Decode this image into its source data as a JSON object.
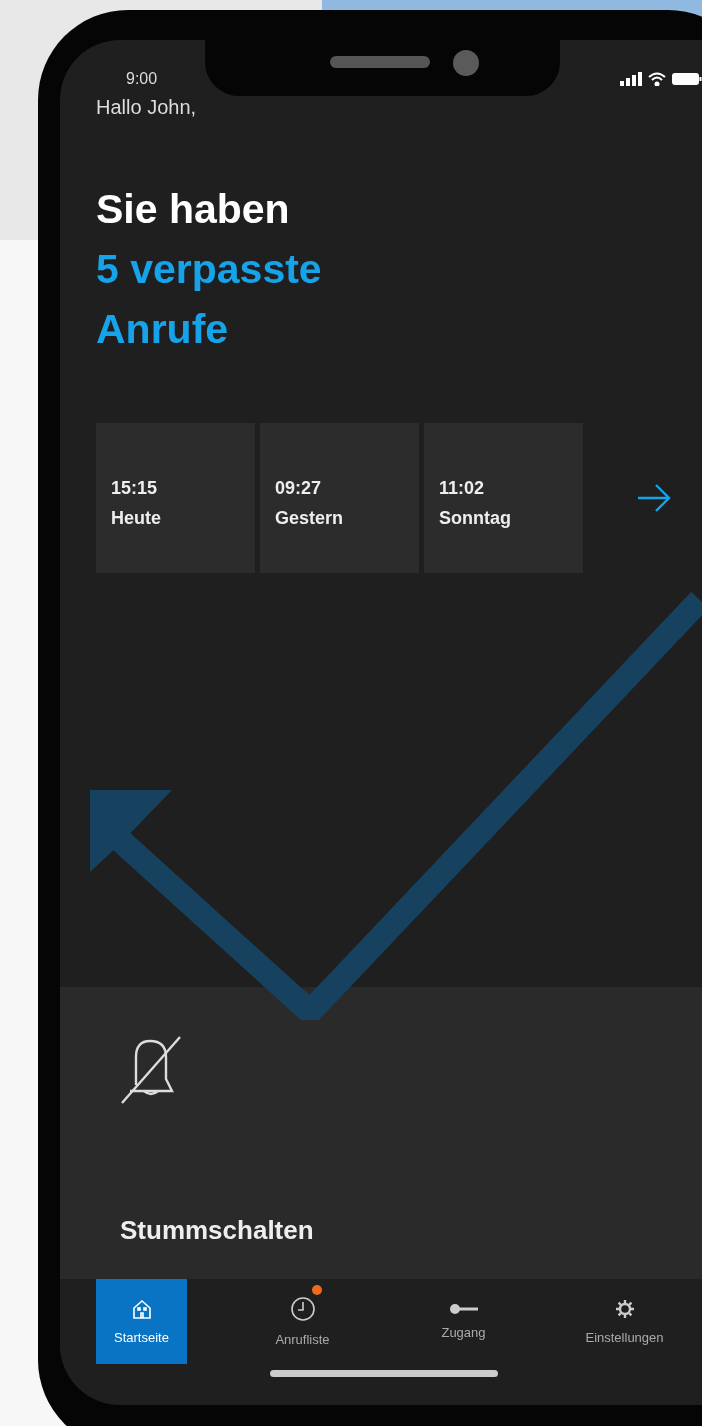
{
  "status_bar": {
    "time": "9:00"
  },
  "greeting": "Hallo John,",
  "headline": {
    "intro": "Sie haben",
    "highlight_lines": [
      "5 verpasste",
      "Anrufe"
    ]
  },
  "missed_calls": [
    {
      "time": "15:15",
      "day": "Heute"
    },
    {
      "time": "09:27",
      "day": "Gestern"
    },
    {
      "time": "11:02",
      "day": "Sonntag"
    }
  ],
  "mute_panel": {
    "label": "Stummschalten"
  },
  "tabs": [
    {
      "label": "Startseite",
      "selected": true,
      "badge": false
    },
    {
      "label": "Anrufliste",
      "selected": false,
      "badge": true
    },
    {
      "label": "Zugang",
      "selected": false,
      "badge": false
    },
    {
      "label": "Einstellungen",
      "selected": false,
      "badge": false
    }
  ]
}
